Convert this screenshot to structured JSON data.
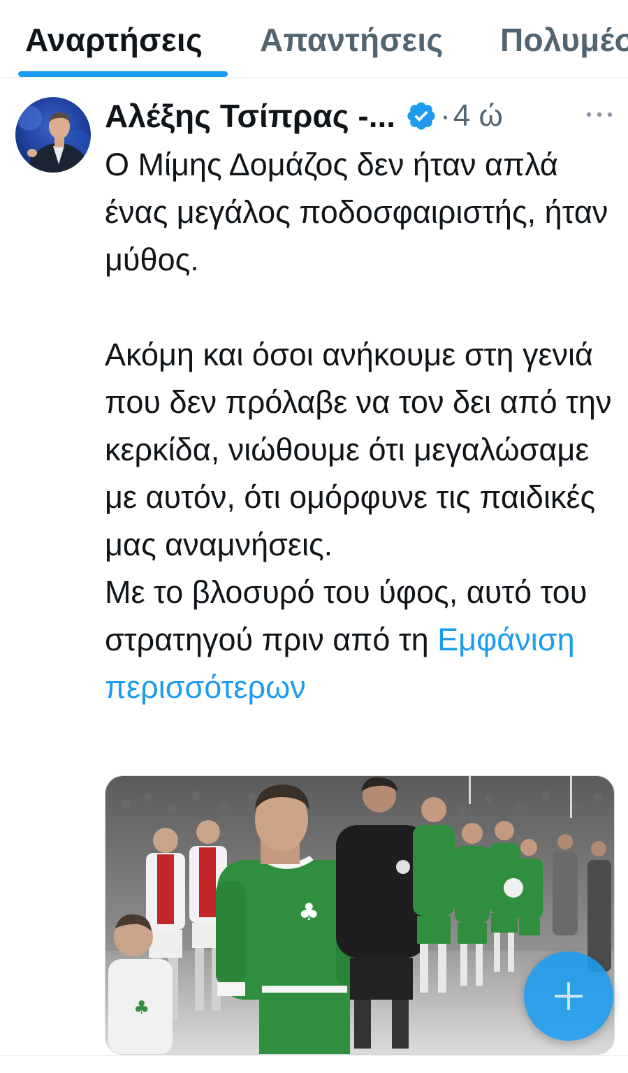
{
  "tabs": {
    "items": [
      {
        "label": "Αναρτήσεις",
        "active": true
      },
      {
        "label": "Απαντήσεις",
        "active": false
      },
      {
        "label": "Πολυμέσα",
        "active": false
      }
    ]
  },
  "post": {
    "author_name": "Αλέξης Τσίπρας -...",
    "verified": true,
    "separator": "·",
    "time": "4 ώ",
    "more_icon": "more-horizontal-icon",
    "paragraph_1": "Ο Μίμης Δομάζος δεν ήταν απλά ένας μεγάλος ποδοσφαιριστής, ήταν μύθος.",
    "paragraph_2": "Ακόμη και όσοι ανήκουμε στη γενιά που δεν πρόλαβε να τον δει από την κερκίδα, νιώθουμε ότι μεγαλώσαμε με αυτόν, ότι ομόρφυνε τις παιδικές μας αναμνήσεις.",
    "paragraph_3": "Με το βλοσυρό του ύφος, αυτό του στρατηγού πριν από τη",
    "show_more": "Εμφάνιση περισσότερων",
    "media_icon": "photo-football-players-walking-out"
  },
  "fab": {
    "icon": "plus-icon"
  },
  "colors": {
    "accent": "#1d9bf0",
    "text": "#0f1419",
    "secondary": "#536471",
    "kit_green": "#2f8f3e",
    "kit_red": "#c4262a"
  }
}
